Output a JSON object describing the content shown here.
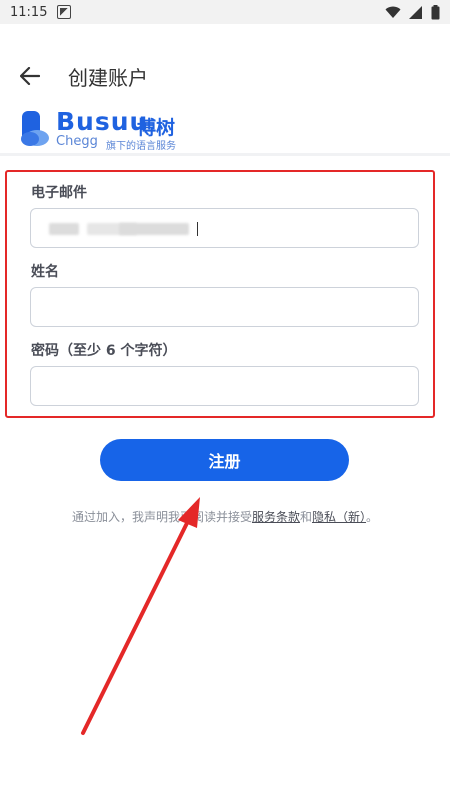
{
  "status_bar": {
    "time": "11:15"
  },
  "header": {
    "back_icon": "arrow-left-icon",
    "title": "创建账户"
  },
  "brand": {
    "name": "Busuu",
    "name_cn": "博树",
    "parent": "Chegg",
    "tagline": "旗下的语言服务",
    "color": "#1f62e0"
  },
  "form": {
    "email_label": "电子邮件",
    "email_value": "",
    "name_label": "姓名",
    "name_value": "",
    "password_label": "密码（至少 6 个字符）",
    "password_value": ""
  },
  "actions": {
    "register_label": "注册",
    "button_color": "#1764e8"
  },
  "terms": {
    "prefix": "通过加入，我声明我已阅读并接受",
    "terms_link": "服务条款",
    "and": "和",
    "privacy_link": "隐私（新）",
    "suffix": "。"
  },
  "annotation": {
    "highlight_color": "#e42828"
  }
}
